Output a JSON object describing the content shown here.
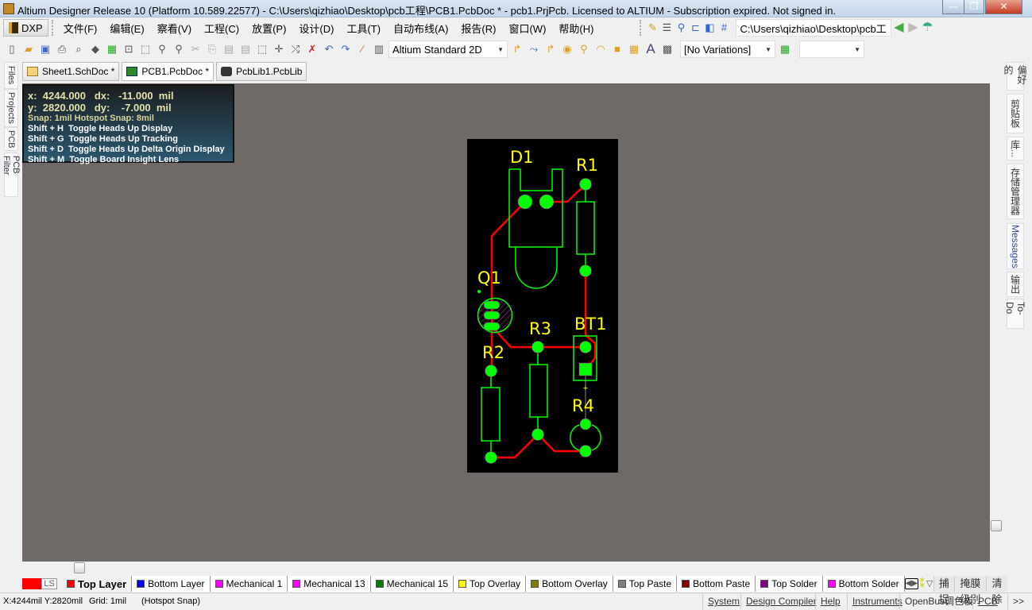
{
  "window": {
    "title": "Altium Designer Release 10 (Platform 10.589.22577) - C:\\Users\\qizhiao\\Desktop\\pcb工程\\PCB1.PcbDoc * - pcb1.PrjPcb. Licensed to ALTIUM - Subscription expired. Not signed in.",
    "minimize": "—",
    "maximize": "❐",
    "close": "✕"
  },
  "menu": {
    "dxp": "DXP",
    "items": [
      "文件(F)",
      "编辑(E)",
      "察看(V)",
      "工程(C)",
      "放置(P)",
      "设计(D)",
      "工具(T)",
      "自动布线(A)",
      "报告(R)",
      "窗口(W)",
      "帮助(H)"
    ],
    "path": "C:\\Users\\qizhiao\\Desktop\\pcb工"
  },
  "toolbar": {
    "view_config": "Altium Standard 2D",
    "variations": "[No Variations]",
    "extra_select": ""
  },
  "doc_tabs": [
    {
      "label": "Sheet1.SchDoc *"
    },
    {
      "label": "PCB1.PcbDoc *",
      "active": true
    },
    {
      "label": "PcbLib1.PcbLib"
    }
  ],
  "left_panels": [
    "Files",
    "Projects",
    "PCB",
    "PCB Filter"
  ],
  "right_panels": [
    "偏好的",
    "剪贴板",
    "库...",
    "存储管理器",
    "Messages",
    "输出",
    "To-Do"
  ],
  "hud": {
    "x_line": "x:  4244.000   dx:   -11.000  mil",
    "y_line": "y:  2820.000   dy:    -7.000  mil",
    "snap": "Snap: 1mil Hotspot Snap: 8mil",
    "shortcuts": [
      "Shift + H  Toggle Heads Up Display",
      "Shift + G  Toggle Heads Up Tracking",
      "Shift + D  Toggle Heads Up Delta Origin Display",
      "Shift + M  Toggle Board Insight Lens"
    ]
  },
  "board": {
    "designators": [
      "D1",
      "R1",
      "Q1",
      "R3",
      "BT1",
      "R2",
      "R4"
    ],
    "colors": {
      "board": "#000000",
      "track": "#ff0000",
      "pad": "#00ff00",
      "overlay": "#00ff00",
      "label": "#ffff00"
    }
  },
  "layers": {
    "ls": "LS",
    "tabs": [
      {
        "label": "Top Layer",
        "color": "#ff0000",
        "active": true
      },
      {
        "label": "Bottom Layer",
        "color": "#0000ff"
      },
      {
        "label": "Mechanical 1",
        "color": "#ff00ff"
      },
      {
        "label": "Mechanical 13",
        "color": "#ff00ff"
      },
      {
        "label": "Mechanical 15",
        "color": "#008000"
      },
      {
        "label": "Top Overlay",
        "color": "#ffff00"
      },
      {
        "label": "Bottom Overlay",
        "color": "#808000"
      },
      {
        "label": "Top Paste",
        "color": "#808080"
      },
      {
        "label": "Bottom Paste",
        "color": "#800000"
      },
      {
        "label": "Top Solder",
        "color": "#800080"
      },
      {
        "label": "Bottom Solder",
        "color": "#ff00ff"
      }
    ],
    "snap": "捕捉",
    "mask_level": "掩膜级别",
    "clear": "清除"
  },
  "status": {
    "coords": "X:4244mil Y:2820mil",
    "grid": "Grid: 1mil",
    "snap": "(Hotspot Snap)",
    "panels": [
      "System",
      "Design Compiler",
      "Help",
      "Instruments",
      "OpenBus调色板",
      "PCB"
    ],
    "more": ">>"
  }
}
